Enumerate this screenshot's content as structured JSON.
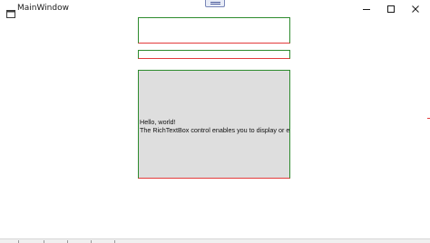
{
  "window": {
    "title": "MainWindow",
    "controls": {
      "minimize": "minimize",
      "maximize": "maximize",
      "close": "close"
    }
  },
  "rich_text_box": {
    "lines": [
      "Hello, world!",
      "The RichTextBox control enables you to display or ed"
    ]
  },
  "colors": {
    "border_green": "#2e8b2e",
    "border_red": "#e23b3b",
    "rtb_background": "#dedede"
  }
}
